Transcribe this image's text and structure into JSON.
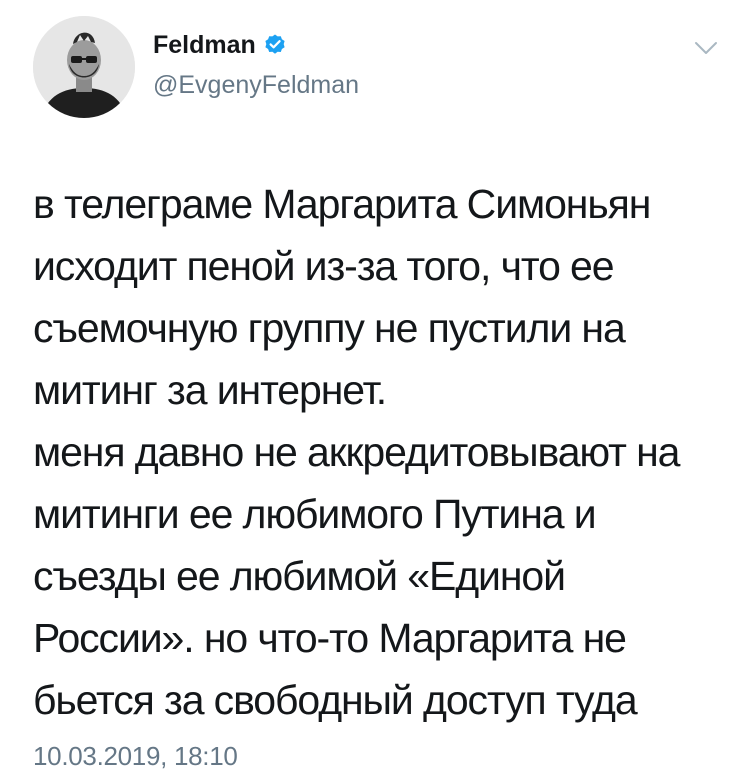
{
  "author": {
    "display_name": "Feldman",
    "handle": "@EvgenyFeldman",
    "verified_icon": "verified-badge-icon",
    "avatar": "profile-photo"
  },
  "menu": {
    "icon": "chevron-down-icon"
  },
  "tweet": {
    "lines": [
      "в телеграме Маргарита Симоньян",
      "исходит пеной из-за того, что ее",
      "съемочную группу не пустили на",
      "митинг за интернет.",
      "меня давно не аккредитовывают на",
      "митинги ее любимого Путина и",
      "съезды ее любимой «Единой",
      "России». но что-то Маргарита не",
      "бьется за свободный доступ туда"
    ],
    "timestamp": "10.03.2019, 18:10"
  },
  "colors": {
    "text": "#14171a",
    "secondary": "#657786",
    "verified_blue": "#1da1f2"
  }
}
